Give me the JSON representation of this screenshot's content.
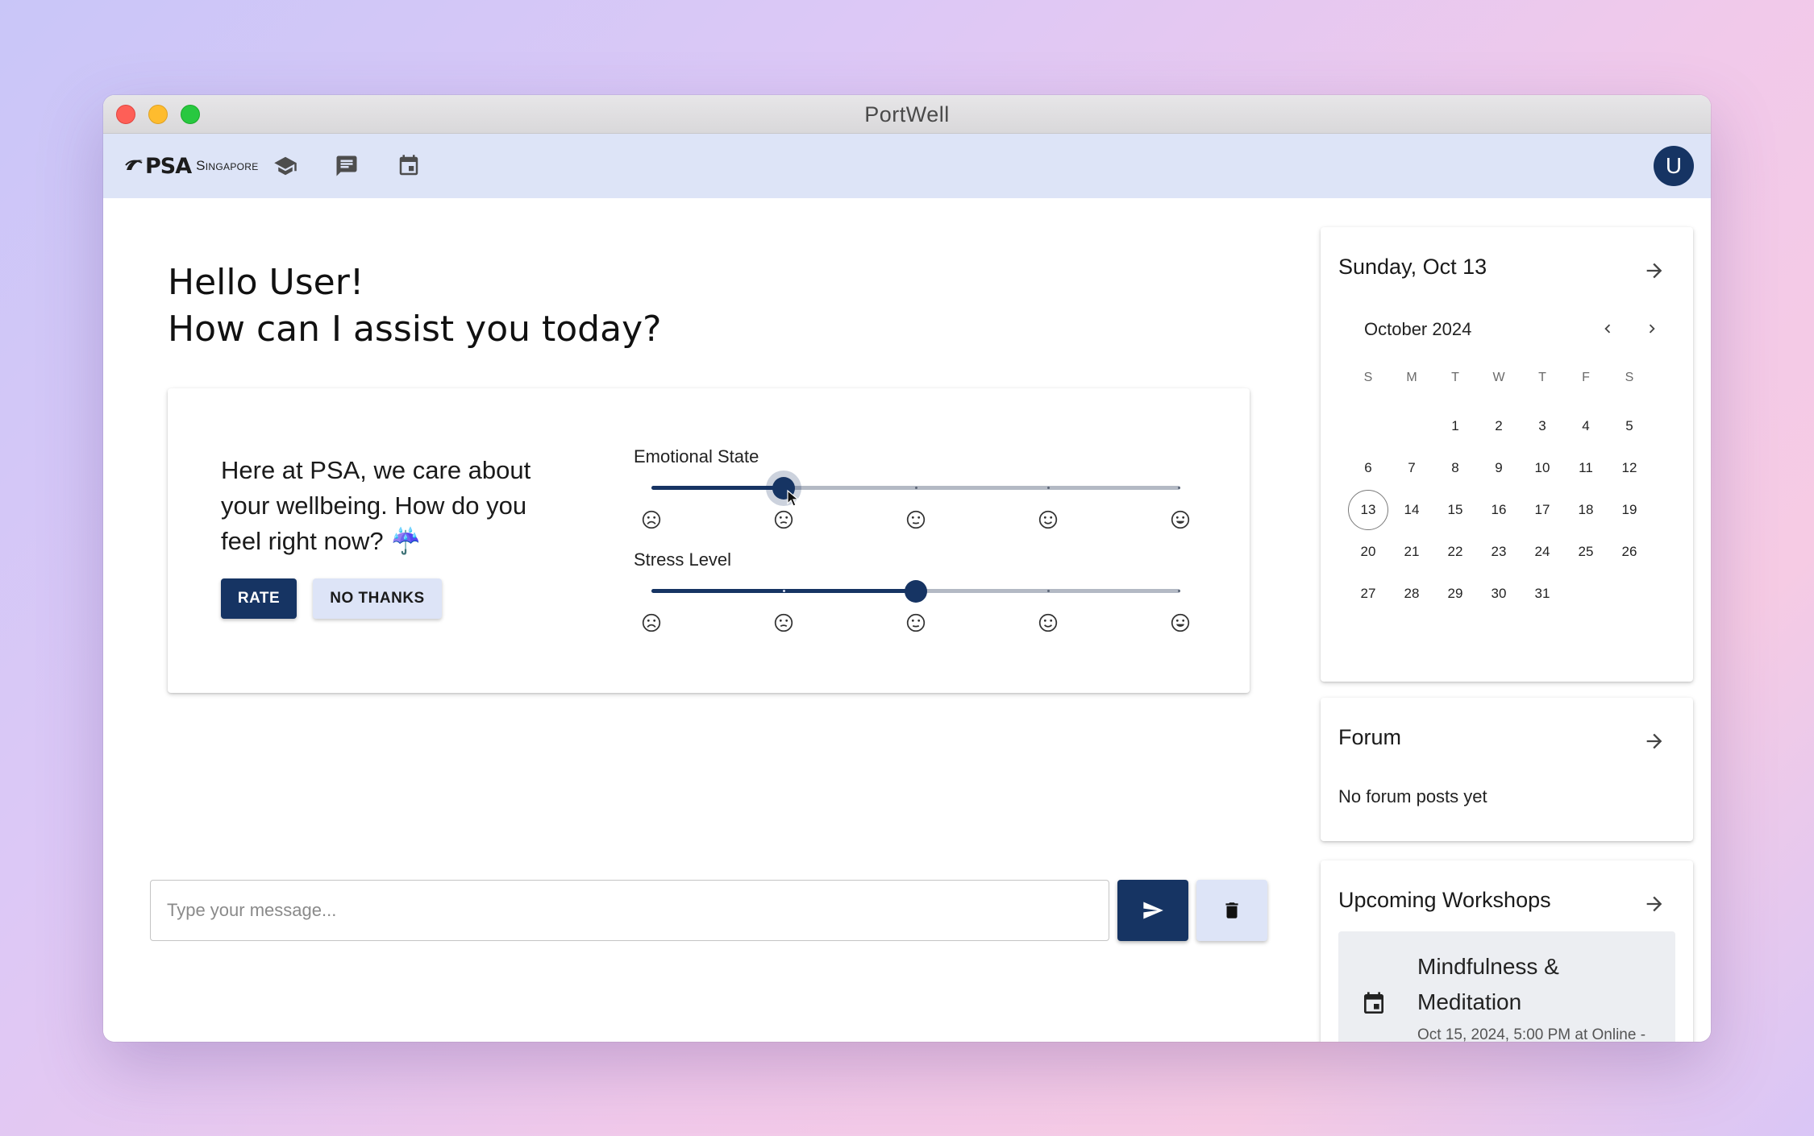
{
  "window": {
    "title": "PortWell"
  },
  "appbar": {
    "logo_mark": "PSA",
    "logo_sub": "Singapore",
    "nav_icons": [
      "school-icon",
      "forum-icon",
      "calendar-icon"
    ],
    "avatar_initial": "U"
  },
  "greeting": {
    "line1": "Hello User!",
    "line2": "How can I assist you today?"
  },
  "rating": {
    "prompt": "Here at PSA, we care about your wellbeing. How do you feel right now? ☔",
    "rate_label": "RATE",
    "no_thanks_label": "NO THANKS",
    "sliders": [
      {
        "label": "Emotional State",
        "value": 2,
        "min": 1,
        "max": 5
      },
      {
        "label": "Stress Level",
        "value": 3,
        "min": 1,
        "max": 5
      }
    ],
    "face_icons": [
      "very-sad-face-icon",
      "sad-face-icon",
      "neutral-face-icon",
      "happy-face-icon",
      "very-happy-face-icon"
    ]
  },
  "chat": {
    "placeholder": "Type your message...",
    "value": ""
  },
  "colors": {
    "primary": "#163463",
    "appbar": "#dde4f7",
    "secondary_button": "#dde4f7"
  },
  "calendar": {
    "heading": "Sunday, Oct 13",
    "month_label": "October 2024",
    "weekdays": [
      "S",
      "M",
      "T",
      "W",
      "T",
      "F",
      "S"
    ],
    "first_weekday_index": 2,
    "days_in_month": 31,
    "today": 13
  },
  "forum": {
    "title": "Forum",
    "empty_text": "No forum posts yet"
  },
  "workshops": {
    "title": "Upcoming Workshops",
    "items": [
      {
        "title": "Mindfulness & Meditation",
        "meta": "Oct 15, 2024, 5:00 PM at Online -"
      }
    ]
  }
}
